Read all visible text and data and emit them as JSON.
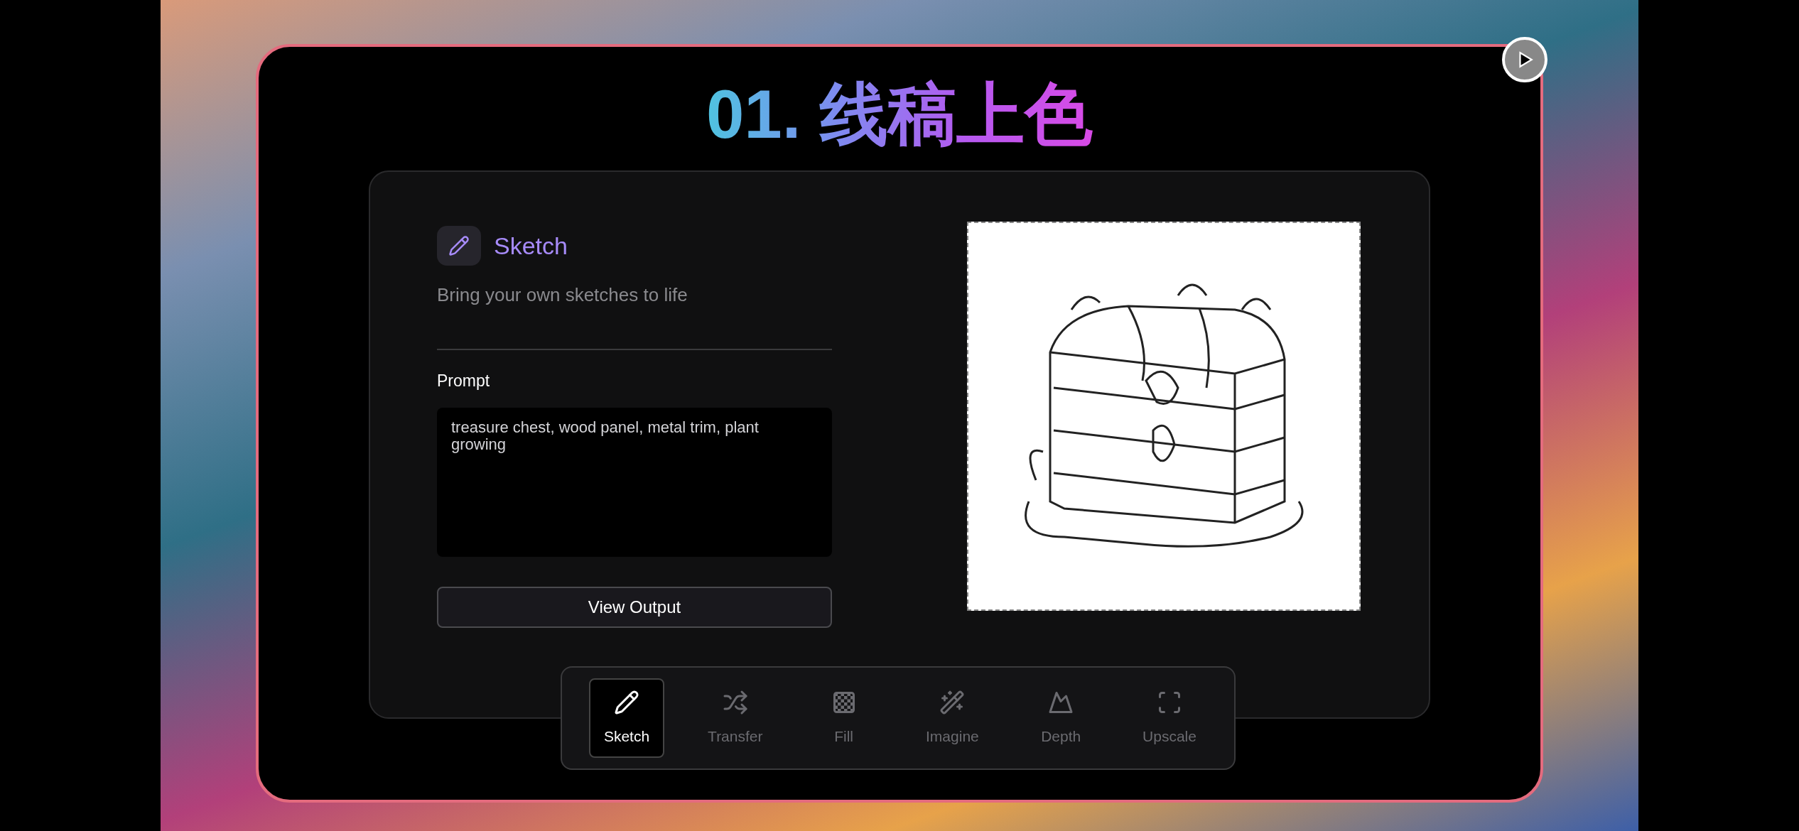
{
  "title": "01. 线稿上色",
  "tool": {
    "name": "Sketch",
    "description": "Bring your own sketches to life"
  },
  "prompt": {
    "label": "Prompt",
    "value": "treasure chest, wood panel, metal trim, plant growing"
  },
  "button": "View Output",
  "toolbar": [
    {
      "kind": "sketch",
      "label": "Sketch",
      "selected": true
    },
    {
      "kind": "transfer",
      "label": "Transfer",
      "selected": false
    },
    {
      "kind": "fill",
      "label": "Fill",
      "selected": false
    },
    {
      "kind": "imagine",
      "label": "Imagine",
      "selected": false
    },
    {
      "kind": "depth",
      "label": "Depth",
      "selected": false
    },
    {
      "kind": "upscale",
      "label": "Upscale",
      "selected": false
    }
  ]
}
